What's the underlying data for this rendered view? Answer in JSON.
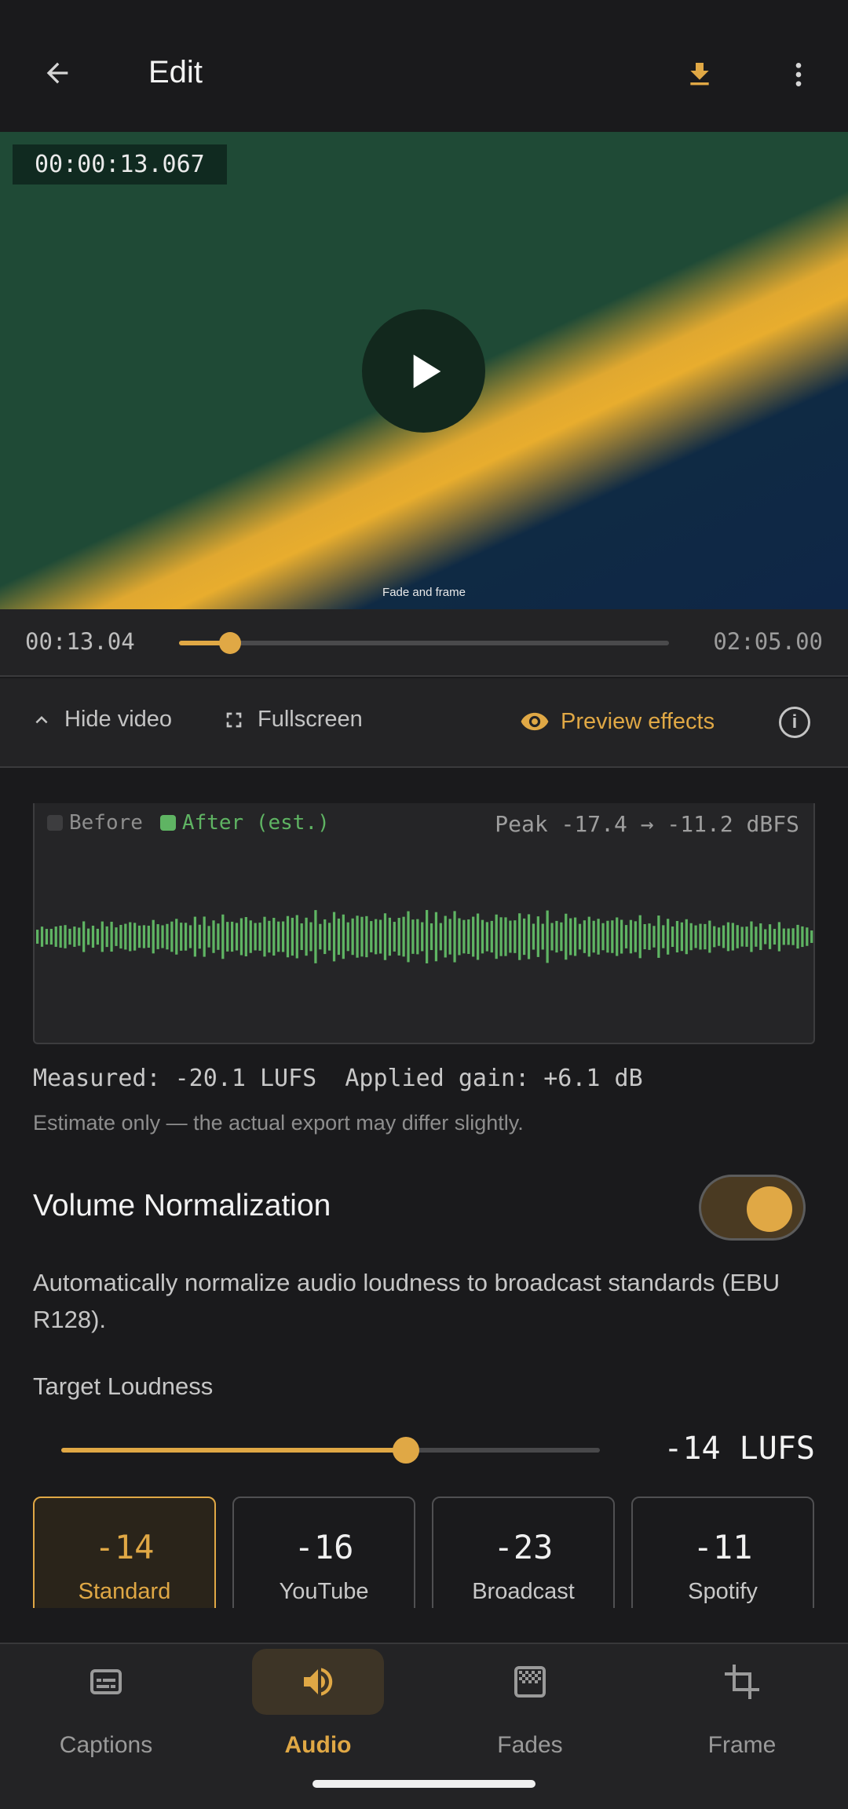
{
  "topbar": {
    "title": "Edit",
    "back_icon": "arrow-left-icon",
    "download_icon": "download-icon",
    "more_icon": "more-vert-icon"
  },
  "video": {
    "timecode": "00:00:13.067",
    "caption": "Fade and frame",
    "play_icon": "play-icon"
  },
  "seek": {
    "current": "00:13.04",
    "duration": "02:05.00",
    "progress": 0.104
  },
  "controls": {
    "hide_video": "Hide video",
    "fullscreen": "Fullscreen",
    "preview_effects": "Preview effects"
  },
  "waveform": {
    "before_label": "Before",
    "after_label": "After (est.)",
    "peak_text": "Peak -17.4 → -11.2 dBFS",
    "colors": {
      "after": "#5fb463",
      "before": "#3d3d3f"
    }
  },
  "measured_text": "Measured: -20.1 LUFS  Applied gain: +6.1 dB",
  "estimate_text": "Estimate only — the actual export may differ slightly.",
  "normalization": {
    "title": "Volume Normalization",
    "enabled": true,
    "description": "Automatically normalize audio loudness to broadcast standards (EBU R128)."
  },
  "target": {
    "label": "Target Loudness",
    "value_text": "-14 LUFS",
    "slider_fraction": 0.64
  },
  "presets": [
    {
      "value": "-14",
      "label": "Standard",
      "selected": true
    },
    {
      "value": "-16",
      "label": "YouTube",
      "selected": false
    },
    {
      "value": "-23",
      "label": "Broadcast",
      "selected": false
    },
    {
      "value": "-11",
      "label": "Spotify",
      "selected": false
    }
  ],
  "nav": [
    {
      "label": "Captions",
      "icon": "captions-icon",
      "active": false
    },
    {
      "label": "Audio",
      "icon": "volume-icon",
      "active": true
    },
    {
      "label": "Fades",
      "icon": "fades-icon",
      "active": false
    },
    {
      "label": "Frame",
      "icon": "crop-icon",
      "active": false
    }
  ],
  "accent_color": "#e0a845"
}
